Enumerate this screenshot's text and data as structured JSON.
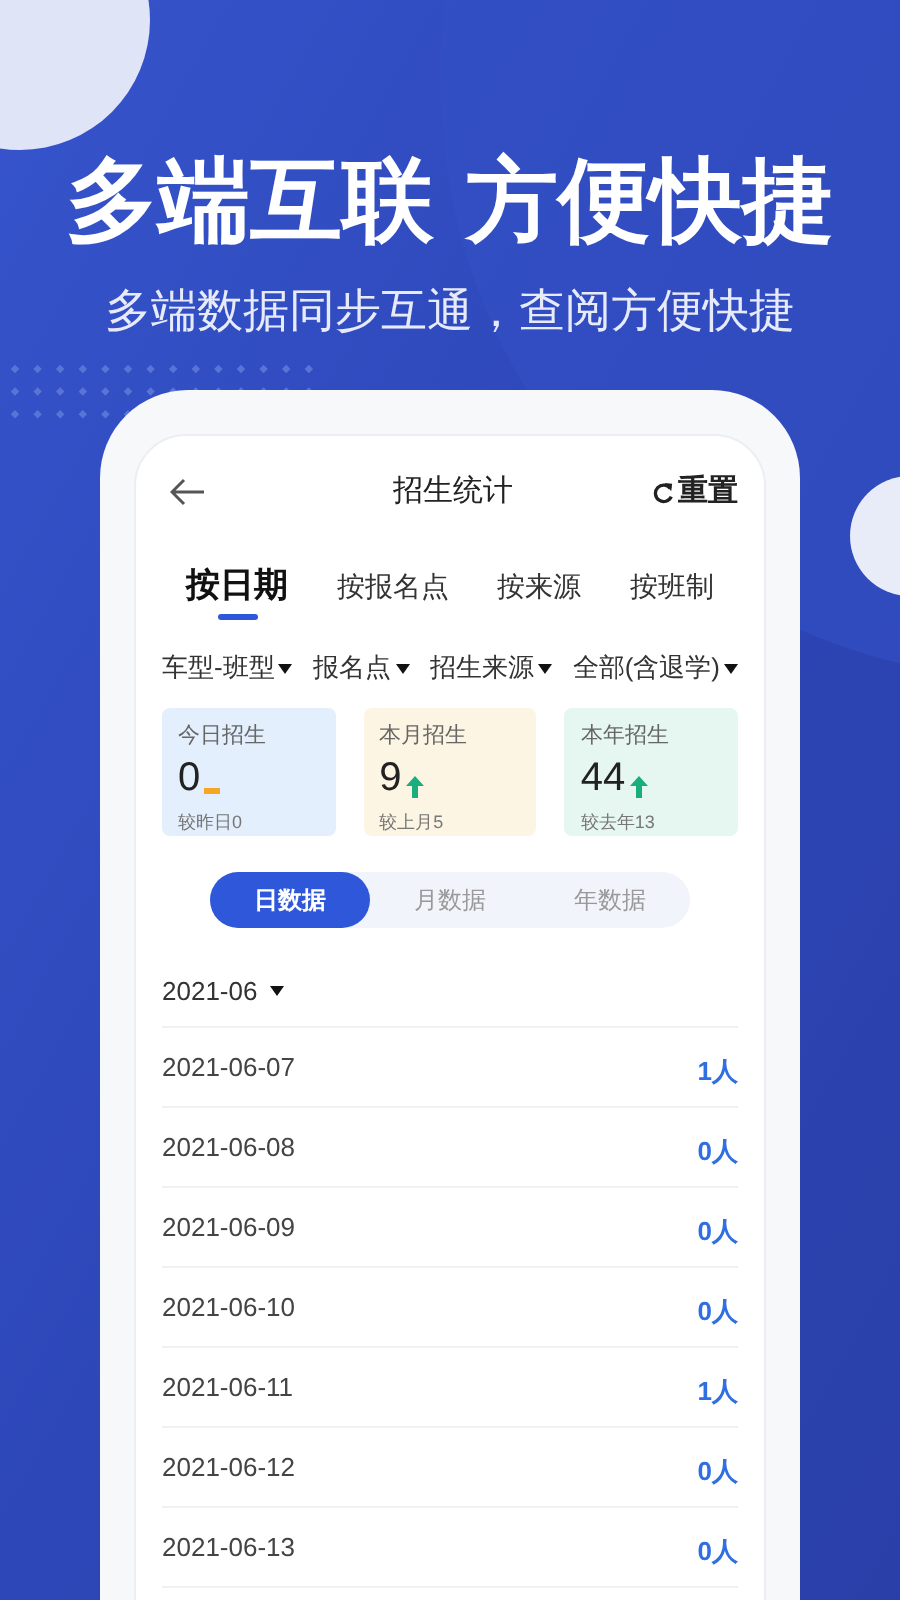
{
  "headline": "多端互联 方便快捷",
  "subtitle": "多端数据同步互通，查阅方便快捷",
  "screen": {
    "title": "招生统计",
    "reset": "重置",
    "tabs": [
      {
        "label": "按日期",
        "selected": true
      },
      {
        "label": "按报名点",
        "selected": false
      },
      {
        "label": "按来源",
        "selected": false
      },
      {
        "label": "按班制",
        "selected": false
      }
    ],
    "filters": [
      "车型-班型",
      "报名点",
      "招生来源",
      "全部(含退学)"
    ],
    "stats": [
      {
        "label": "今日招生",
        "value": "0",
        "kind": "flat",
        "compare": "较昨日0",
        "color": "#e3effd"
      },
      {
        "label": "本月招生",
        "value": "9",
        "kind": "up",
        "compare": "较上月5",
        "color": "#fcf5e3"
      },
      {
        "label": "本年招生",
        "value": "44",
        "kind": "up",
        "compare": "较去年13",
        "color": "#e6f6f1"
      }
    ],
    "periods": [
      {
        "label": "日数据",
        "selected": true
      },
      {
        "label": "月数据",
        "selected": false
      },
      {
        "label": "年数据",
        "selected": false
      }
    ],
    "month": "2021-06",
    "rows": [
      {
        "date": "2021-06-07",
        "count": "1人"
      },
      {
        "date": "2021-06-08",
        "count": "0人"
      },
      {
        "date": "2021-06-09",
        "count": "0人"
      },
      {
        "date": "2021-06-10",
        "count": "0人"
      },
      {
        "date": "2021-06-11",
        "count": "1人"
      },
      {
        "date": "2021-06-12",
        "count": "0人"
      },
      {
        "date": "2021-06-13",
        "count": "0人"
      }
    ]
  }
}
